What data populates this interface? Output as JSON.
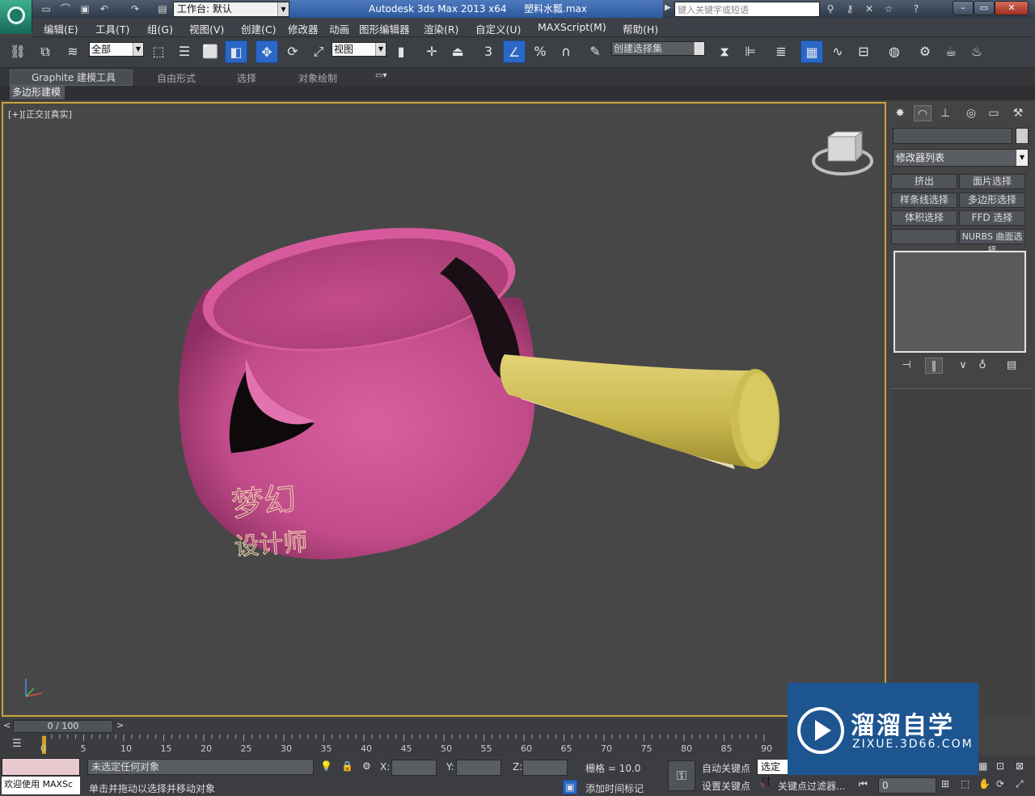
{
  "titlebar": {
    "workspace": "工作台: 默认",
    "app_title": "Autodesk 3ds Max  2013 x64",
    "file_name": "塑料水瓢.max",
    "search_placeholder": "键入关键字或短语"
  },
  "menubar": [
    "编辑(E)",
    "工具(T)",
    "组(G)",
    "视图(V)",
    "创建(C)",
    "修改器",
    "动画",
    "图形编辑器",
    "渲染(R)",
    "自定义(U)",
    "MAXScript(M)",
    "帮助(H)"
  ],
  "toolbar": {
    "selection_filter": "全部",
    "ref_coord": "视图",
    "named_selection": "创建选择集",
    "snap_toggle_label": "3",
    "percent_snap_label": "%"
  },
  "ribbon": {
    "tabs": [
      "Graphite 建模工具",
      "自由形式",
      "选择",
      "对象绘制"
    ],
    "active_sub": "多边形建模"
  },
  "viewport": {
    "label": "[+][正交][真实]",
    "watermark_chars": [
      "梦",
      "幻",
      "设",
      "计",
      "师"
    ]
  },
  "colors": {
    "pot": "#c95092",
    "handle": "#cfc05a",
    "viewport_border": "#c9a43a",
    "status_color_swatch": "#e8c9cf"
  },
  "cmdpanel": {
    "modifier_list": "修改器列表",
    "buttons": [
      "挤出",
      "面片选择",
      "样条线选择",
      "多边形选择",
      "体积选择",
      "FFD 选择",
      "",
      "NURBS 曲面选择"
    ]
  },
  "timeslider": {
    "frame": "0 / 100",
    "ticks": [
      "0",
      "5",
      "10",
      "15",
      "20",
      "25",
      "30",
      "35",
      "40",
      "45",
      "50",
      "55",
      "60",
      "65",
      "70",
      "75",
      "80",
      "85",
      "90"
    ]
  },
  "statusbar": {
    "script_label": "欢迎使用 MAXSc",
    "status_text": "未选定任何对象",
    "prompt_text": "单击并拖动以选择并移动对象",
    "x_label": "X:",
    "y_label": "Y:",
    "z_label": "Z:",
    "grid": "栅格 = 10.0",
    "add_time_tag": "添加时间标记",
    "auto_key": "自动关键点",
    "set_key": "设置关键点",
    "selected_dropdown": "选定对",
    "key_filters": "关键点过滤器...",
    "frame_value": "0"
  },
  "watermark": {
    "brand": "溜溜自学",
    "url": "ZIXUE.3D66.COM"
  }
}
